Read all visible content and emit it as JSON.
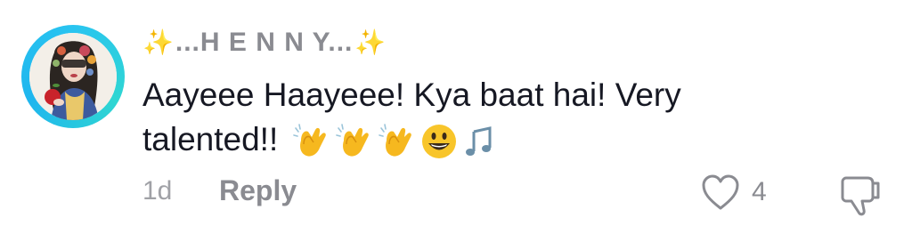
{
  "comment": {
    "username": "...H E N N Y...",
    "username_prefix_icon": "sparkles",
    "username_suffix_icon": "sparkles",
    "text": "Aayeee Haayeee! Kya baat hai! Very talented!!",
    "emojis": [
      "clapping-hands",
      "clapping-hands",
      "clapping-hands",
      "grinning-face",
      "musical-notes"
    ],
    "time": "1d",
    "reply_label": "Reply",
    "like_count": "4",
    "avatar_ring_color": "#29c4f0"
  }
}
